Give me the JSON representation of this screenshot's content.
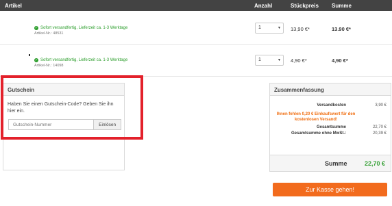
{
  "table": {
    "headers": {
      "article": "Artikel",
      "quantity": "Anzahl",
      "unit_price": "Stückpreis",
      "total": "Summe"
    },
    "rows": [
      {
        "availability": "Sofort versandfertig, Lieferzeit ca. 1-3 Werktage",
        "article_no": "Artikel-Nr.: 48531",
        "quantity": "1",
        "unit_price": "13,90 €*",
        "total": "13.90 €*"
      },
      {
        "availability": "Sofort versandfertig, Lieferzeit ca. 1-3 Werktage",
        "article_no": "Artikel-Nr.: 14098",
        "quantity": "1",
        "unit_price": "4,90 €*",
        "total": "4,90 €*"
      }
    ]
  },
  "voucher": {
    "title": "Gutschein",
    "text": "Haben Sie einen Gutschein-Code? Geben Sie ihn hier ein.",
    "placeholder": "Gutschein-Nummer",
    "button": "Einlösen"
  },
  "summary": {
    "title": "Zusammenfassung",
    "shipping_label": "Versandkosten",
    "shipping_value": "3,90 €",
    "free_shipping_note": "Ihnen fehlen 0,20 € Einkaufswert für den kostenlosen Versand!",
    "subtotal_label": "Gesamtsumme",
    "subtotal_value": "22,70 €",
    "net_label": "Gesamtsumme ohne MwSt.:",
    "net_value": "20,39 €",
    "total_label": "Summe",
    "total_value": "22,70 €"
  },
  "checkout": {
    "label": "Zur Kasse gehen!"
  },
  "colors": {
    "header_bg": "#434343",
    "availability_green": "#2a9d2a",
    "highlight_red": "#e3212b",
    "note_orange": "#f06d0f",
    "total_green": "#37a137",
    "checkout_orange": "#f26b1d"
  }
}
